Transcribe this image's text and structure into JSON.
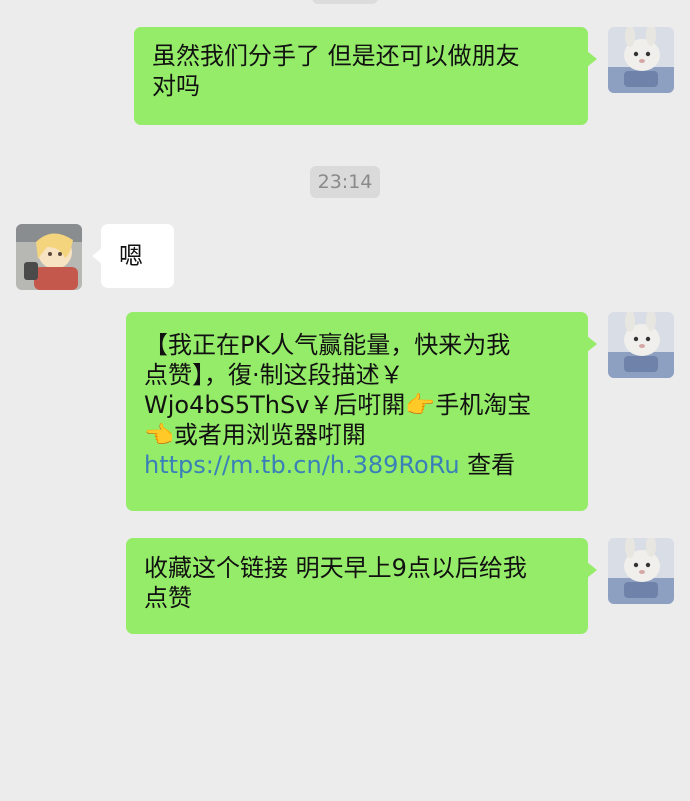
{
  "chat": {
    "messages": [
      {
        "id": "m1",
        "side": "right",
        "text": "虽然我们分手了 但是还可以做朋友\n对吗"
      },
      {
        "id": "t1",
        "type": "time",
        "text": "23:14"
      },
      {
        "id": "m2",
        "side": "left",
        "text": "嗯"
      },
      {
        "id": "m3",
        "side": "right",
        "lines": [
          "【我正在PK人气赢能量，快来为我",
          "点赞】，復·制这段描述￥",
          "Wjo4bS5ThSv￥后咑閞👉手机淘宝",
          "👈或者用浏览器咑閞"
        ],
        "link": "https://m.tb.cn/h.389RoRu",
        "link_suffix": " 查看"
      },
      {
        "id": "m4",
        "side": "right",
        "text": "收藏这个链接 明天早上9点以后给我\n点赞"
      }
    ]
  },
  "colors": {
    "background": "#ececec",
    "sent_bubble": "#95ec69",
    "received_bubble": "#ffffff",
    "link": "#3a80b8",
    "timestamp_bg": "#dadada",
    "timestamp_text": "#8a8a8a"
  },
  "icons": {
    "self_avatar": "rabbit-avatar-icon",
    "other_avatar": "anime-avatar-icon"
  }
}
